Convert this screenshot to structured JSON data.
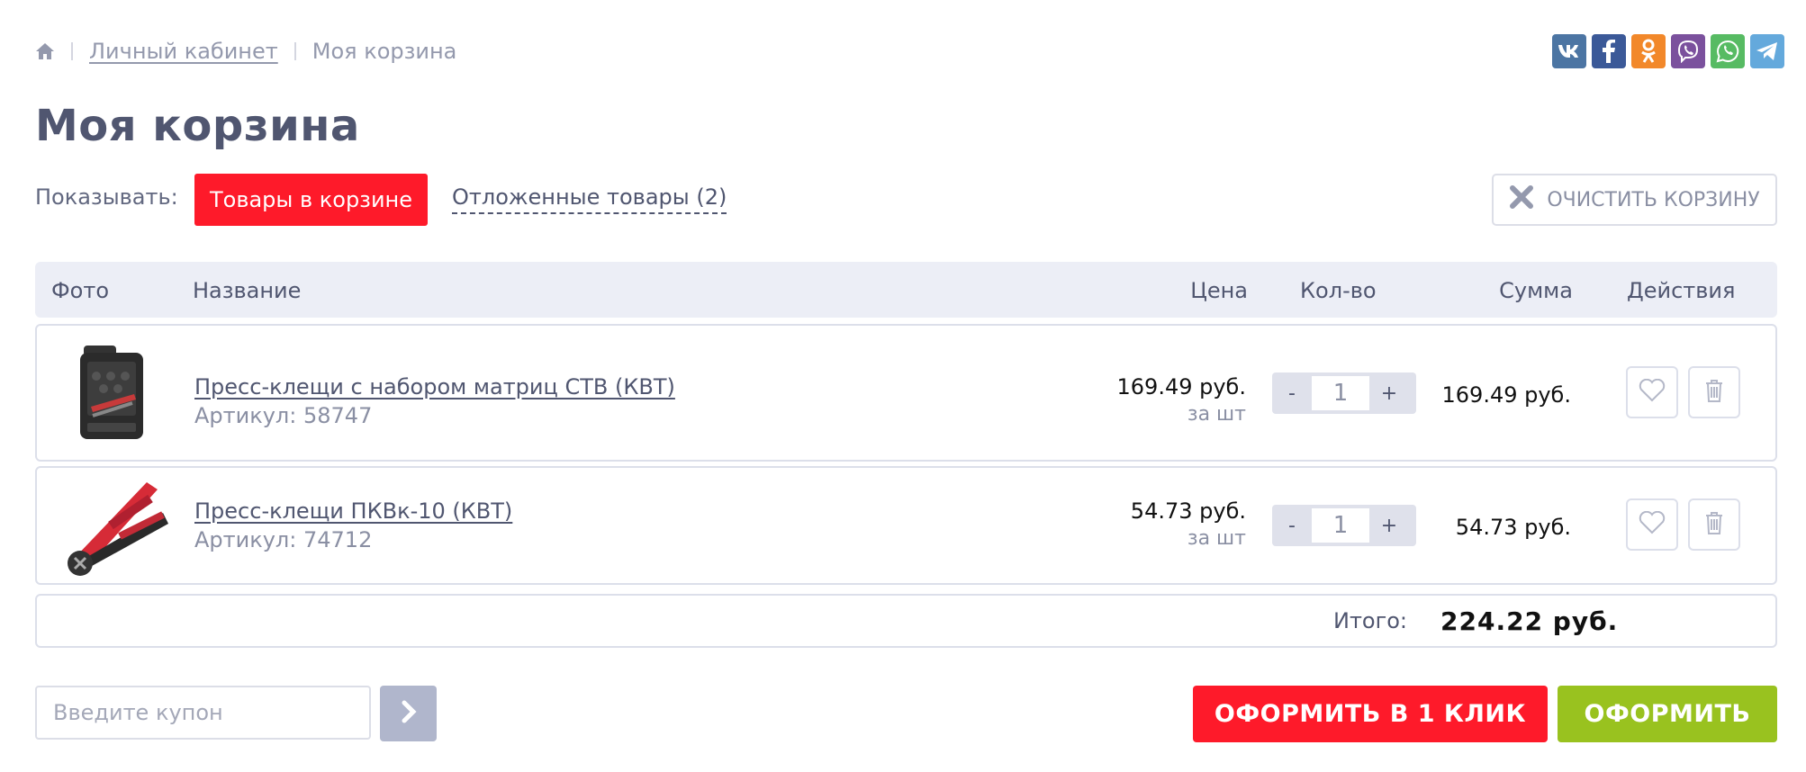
{
  "breadcrumb": {
    "home_icon": "home-icon",
    "items": [
      "Личный кабинет",
      "Моя корзина"
    ]
  },
  "social": [
    {
      "name": "vk",
      "label": "vk",
      "color": "#4c75a3"
    },
    {
      "name": "facebook",
      "label": "f",
      "color": "#3b5998"
    },
    {
      "name": "odnoklassniki",
      "label": "ok",
      "color": "#f2882a"
    },
    {
      "name": "viber",
      "label": "viber",
      "color": "#7b519d"
    },
    {
      "name": "whatsapp",
      "label": "wa",
      "color": "#57bb63"
    },
    {
      "name": "telegram",
      "label": "tg",
      "color": "#64a9dc"
    }
  ],
  "page_title": "Моя корзина",
  "filter": {
    "label": "Показывать:",
    "active_tab": "Товары в корзине",
    "other_tab": "Отложенные товары (2)"
  },
  "clear_button": "ОЧИСТИТЬ КОРЗИНУ",
  "table": {
    "headers": {
      "photo": "Фото",
      "name": "Название",
      "price": "Цена",
      "qty": "Кол-во",
      "sum": "Сумма",
      "actions": "Действия"
    },
    "rows": [
      {
        "name": "Пресс-клещи с набором матриц СТВ (КВТ)",
        "sku": "Артикул: 58747",
        "price": "169.49 руб.",
        "unit": "за шт",
        "qty": "1",
        "sum": "169.49 руб."
      },
      {
        "name": "Пресс-клещи ПКВк-10 (КВТ)",
        "sku": "Артикул: 74712",
        "price": "54.73 руб.",
        "unit": "за шт",
        "qty": "1",
        "sum": "54.73 руб."
      }
    ],
    "qty_minus": "-",
    "qty_plus": "+"
  },
  "total": {
    "label": "Итого:",
    "value": "224.22 руб."
  },
  "coupon": {
    "placeholder": "Введите купон"
  },
  "buttons": {
    "one_click": "ОФОРМИТЬ В 1 КЛИК",
    "checkout": "ОФОРМИТЬ"
  },
  "colors": {
    "accent_red": "#fe1a2a",
    "accent_green": "#99c21f",
    "header_bg": "#eceef6"
  }
}
